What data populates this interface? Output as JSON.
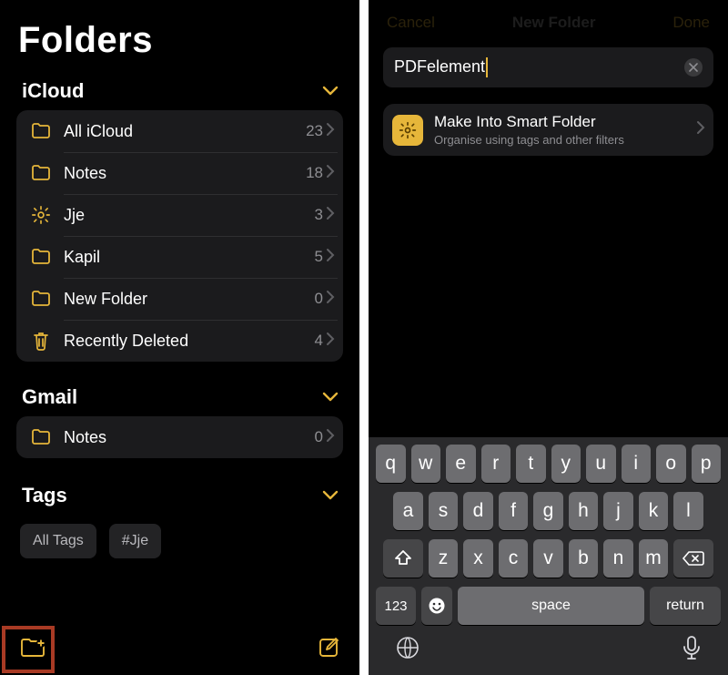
{
  "left": {
    "title": "Folders",
    "sections": [
      {
        "header": "iCloud",
        "rows": [
          {
            "icon": "folder-icon",
            "label": "All iCloud",
            "count": "23"
          },
          {
            "icon": "folder-icon",
            "label": "Notes",
            "count": "18"
          },
          {
            "icon": "gear-icon",
            "label": "Jje",
            "count": "3"
          },
          {
            "icon": "folder-icon",
            "label": "Kapil",
            "count": "5"
          },
          {
            "icon": "folder-icon",
            "label": "New Folder",
            "count": "0"
          },
          {
            "icon": "trash-icon",
            "label": "Recently Deleted",
            "count": "4"
          }
        ]
      },
      {
        "header": "Gmail",
        "rows": [
          {
            "icon": "folder-icon",
            "label": "Notes",
            "count": "0"
          }
        ]
      }
    ],
    "tags_header": "Tags",
    "tags": [
      "All Tags",
      "#Jje"
    ]
  },
  "right": {
    "nav": {
      "cancel": "Cancel",
      "title": "New Folder",
      "done": "Done"
    },
    "input_value": "PDFelement",
    "smart": {
      "title": "Make Into Smart Folder",
      "subtitle": "Organise using tags and other filters"
    },
    "keyboard": {
      "row1": [
        "q",
        "w",
        "e",
        "r",
        "t",
        "y",
        "u",
        "i",
        "o",
        "p"
      ],
      "row2": [
        "a",
        "s",
        "d",
        "f",
        "g",
        "h",
        "j",
        "k",
        "l"
      ],
      "row3": [
        "z",
        "x",
        "c",
        "v",
        "b",
        "n",
        "m"
      ],
      "numkey": "123",
      "space": "space",
      "return": "return"
    }
  }
}
